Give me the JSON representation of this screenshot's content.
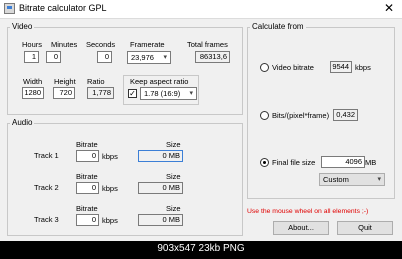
{
  "window": {
    "title": "Bitrate calculator GPL",
    "icon": "app-icon",
    "close_glyph": "✕"
  },
  "video": {
    "group_title": "Video",
    "hours_label": "Hours",
    "hours_value": "1",
    "minutes_label": "Minutes",
    "minutes_value": "0",
    "seconds_label": "Seconds",
    "seconds_value": "0",
    "framerate_label": "Framerate",
    "framerate_value": "23,976",
    "total_frames_label": "Total frames",
    "total_frames_value": "86313,6",
    "width_label": "Width",
    "width_value": "1280",
    "height_label": "Height",
    "height_value": "720",
    "ratio_label": "Ratio",
    "ratio_value": "1,778",
    "keep_aspect_label": "Keep aspect ratio",
    "keep_aspect_checked": true,
    "keep_aspect_check_glyph": "✓",
    "aspect_value": "1.78 (16:9)"
  },
  "audio": {
    "group_title": "Audio",
    "tracks": [
      {
        "label": "Track 1",
        "bitrate_label": "Bitrate",
        "bitrate_value": "0",
        "unit": "kbps",
        "size_label": "Size",
        "size_value": "0 MB"
      },
      {
        "label": "Track 2",
        "bitrate_label": "Bitrate",
        "bitrate_value": "0",
        "unit": "kbps",
        "size_label": "Size",
        "size_value": "0 MB"
      },
      {
        "label": "Track 3",
        "bitrate_label": "Bitrate",
        "bitrate_value": "0",
        "unit": "kbps",
        "size_label": "Size",
        "size_value": "0 MB"
      }
    ]
  },
  "calculate": {
    "group_title": "Calculate from",
    "video_bitrate_label": "Video bitrate",
    "video_bitrate_value": "9544",
    "video_bitrate_unit": "kbps",
    "bits_label": "Bits/(pixel*frame)",
    "bits_value": "0,432",
    "final_size_label": "Final file size",
    "final_size_value": "4096",
    "final_size_unit": "MB",
    "size_preset": "Custom",
    "selected": "final_size"
  },
  "hint": "Use the mouse wheel on all elements ;-)",
  "buttons": {
    "about": "About...",
    "quit": "Quit"
  },
  "footer": "903x547 23kb PNG",
  "colors": {
    "hint": "#e00000",
    "accent": "#3c7fd6",
    "window_bg": "#f0f0f0"
  }
}
